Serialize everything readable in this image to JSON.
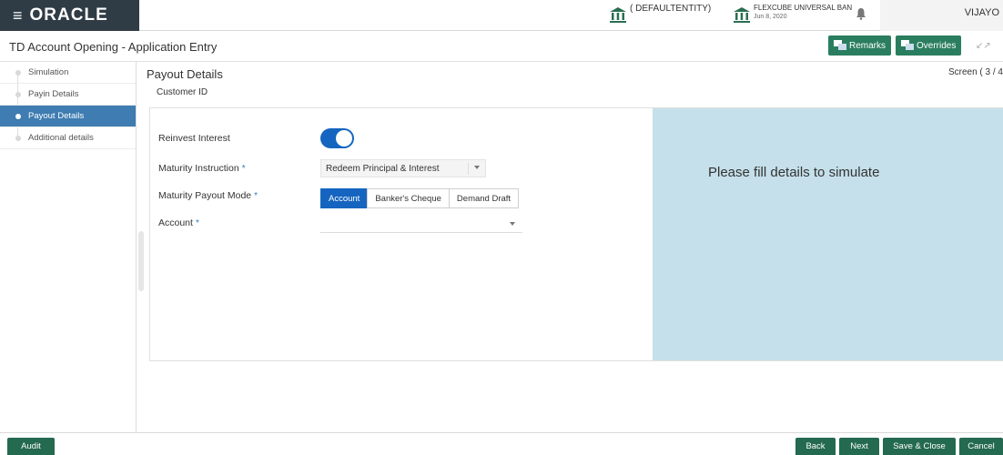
{
  "header": {
    "logo": "ORACLE",
    "entity_label": "( DEFAULTENTITY)",
    "bank_name": "FLEXCUBE UNIVERSAL BAN",
    "bank_date": "Jun 8, 2020",
    "user": "VIJAYO"
  },
  "titlebar": {
    "title": "TD Account Opening - Application Entry",
    "remarks_label": "Remarks",
    "overrides_label": "Overrides"
  },
  "sidebar": {
    "steps": [
      {
        "label": "Simulation"
      },
      {
        "label": "Payin Details"
      },
      {
        "label": "Payout Details"
      },
      {
        "label": "Additional details"
      }
    ]
  },
  "main": {
    "title": "Payout Details",
    "screen_indicator": "Screen ( 3 / 4",
    "customer_id_label": "Customer ID",
    "form": {
      "reinvest_label": "Reinvest Interest",
      "reinvest_on": true,
      "maturity_instruction_label": "Maturity Instruction",
      "maturity_instruction_value": "Redeem Principal & Interest",
      "payout_mode_label": "Maturity Payout Mode",
      "payout_modes": [
        "Account",
        "Banker's Cheque",
        "Demand Draft"
      ],
      "payout_mode_selected": "Account",
      "account_label": "Account",
      "account_value": "",
      "required_mark": "*"
    },
    "simulate_message": "Please fill details to simulate"
  },
  "footer": {
    "audit_label": "Audit",
    "back_label": "Back",
    "next_label": "Next",
    "save_close_label": "Save & Close",
    "cancel_label": "Cancel"
  },
  "colors": {
    "brand_dark": "#2f3b45",
    "action_green": "#2a7e5f",
    "active_blue": "#3e7cb1",
    "toggle_blue": "#1565c0",
    "simulate_bg": "#c5e0ea"
  }
}
